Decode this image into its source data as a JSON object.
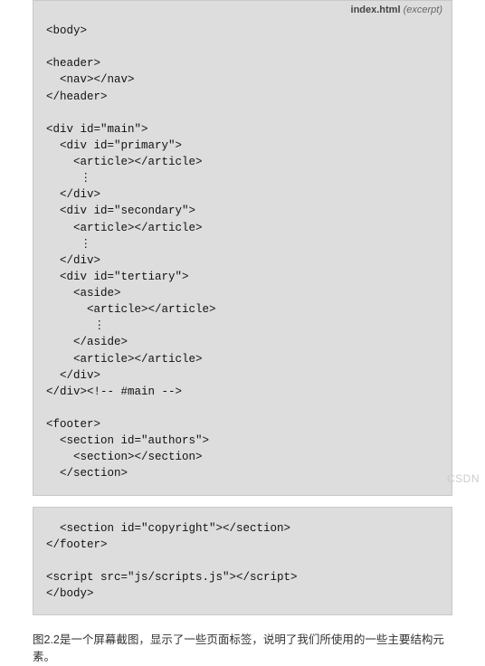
{
  "header": {
    "filename": "index.html",
    "excerpt": " (excerpt)"
  },
  "code_block_1": "<body>\n\n<header>\n  <nav></nav>\n</header>\n\n<div id=\"main\">\n  <div id=\"primary\">\n    <article></article>\n     ⋮\n  </div>\n  <div id=\"secondary\">\n    <article></article>\n     ⋮\n  </div>\n  <div id=\"tertiary\">\n    <aside>\n      <article></article>\n       ⋮\n    </aside>\n    <article></article>\n  </div>\n</div><!-- #main -->\n\n<footer>\n  <section id=\"authors\">\n    <section></section>\n  </section>",
  "code_block_2": "  <section id=\"copyright\"></section>\n</footer>\n\n<script src=\"js/scripts.js\"></script>\n</body>",
  "caption": "图2.2是一个屏幕截图，显示了一些页面标签，说明了我们所使用的一些主要结构元素。",
  "watermark": "CSDN"
}
